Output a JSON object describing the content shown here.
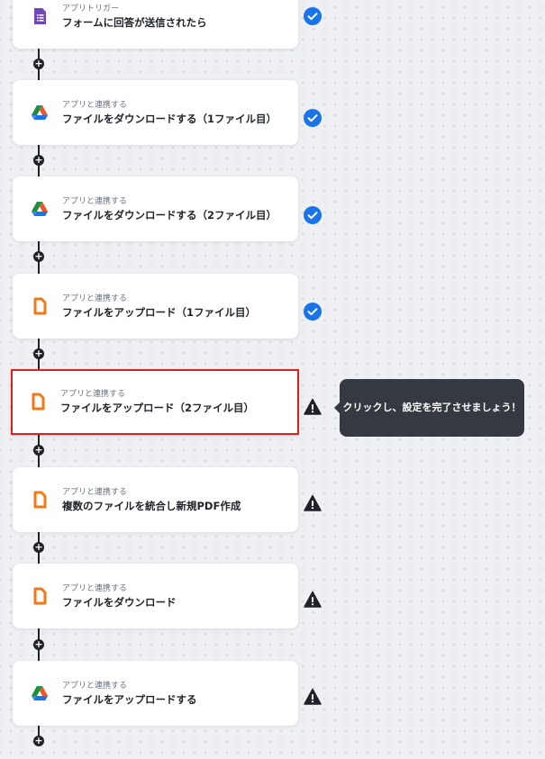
{
  "steps": [
    {
      "icon": "google-forms-icon",
      "sub": "アプリトリガー",
      "title": "フォームに回答が送信されたら",
      "status": "complete"
    },
    {
      "icon": "google-drive-icon",
      "sub": "アプリと連携する",
      "title": "ファイルをダウンロードする（1ファイル目）",
      "status": "complete"
    },
    {
      "icon": "google-drive-icon",
      "sub": "アプリと連携する",
      "title": "ファイルをダウンロードする（2ファイル目）",
      "status": "complete"
    },
    {
      "icon": "document-app-icon",
      "sub": "アプリと連携する",
      "title": "ファイルをアップロード（1ファイル目）",
      "status": "complete"
    },
    {
      "icon": "document-app-icon",
      "sub": "アプリと連携する",
      "title": "ファイルをアップロード（2ファイル目）",
      "status": "warning"
    },
    {
      "icon": "document-app-icon",
      "sub": "アプリと連携する",
      "title": "複数のファイルを統合し新規PDF作成",
      "status": "warning"
    },
    {
      "icon": "document-app-icon",
      "sub": "アプリと連携する",
      "title": "ファイルをダウンロード",
      "status": "warning"
    },
    {
      "icon": "google-drive-icon",
      "sub": "アプリと連携する",
      "title": "ファイルをアップロードする",
      "status": "warning"
    }
  ],
  "tooltip": {
    "text": "クリックし、設定を完了させましょう！"
  },
  "colors": {
    "check": "#1a73e8",
    "warning": "#1f2329",
    "selected_border": "#e01e1e",
    "tooltip_bg": "#353a42",
    "doc_orange": "#f07a1a",
    "forms_purple": "#7248b9"
  }
}
